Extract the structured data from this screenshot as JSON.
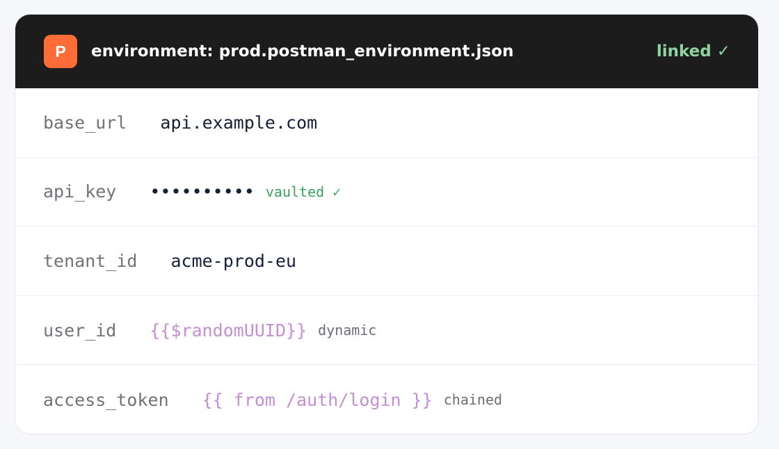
{
  "header": {
    "logo_letter": "P",
    "title": "environment: prod.postman_environment.json",
    "status_label": "linked",
    "status_icon": "✓"
  },
  "variables": [
    {
      "key": "base_url",
      "value": "api.example.com",
      "tag": ""
    },
    {
      "key": "api_key",
      "value": "••••••••••",
      "tag": "vaulted ✓"
    },
    {
      "key": "tenant_id",
      "value": "acme-prod-eu",
      "tag": ""
    },
    {
      "key": "user_id",
      "value": "{{$randomUUID}}",
      "tag": "dynamic"
    },
    {
      "key": "access_token",
      "value": "{{ from /auth/login }}",
      "tag": "chained"
    }
  ],
  "colors": {
    "header_bg": "#1c1c1c",
    "logo_bg": "#ff6c37",
    "linked": "#8ed3a0",
    "template_value": "#c48fd3",
    "vaulted": "#3aa35b"
  }
}
